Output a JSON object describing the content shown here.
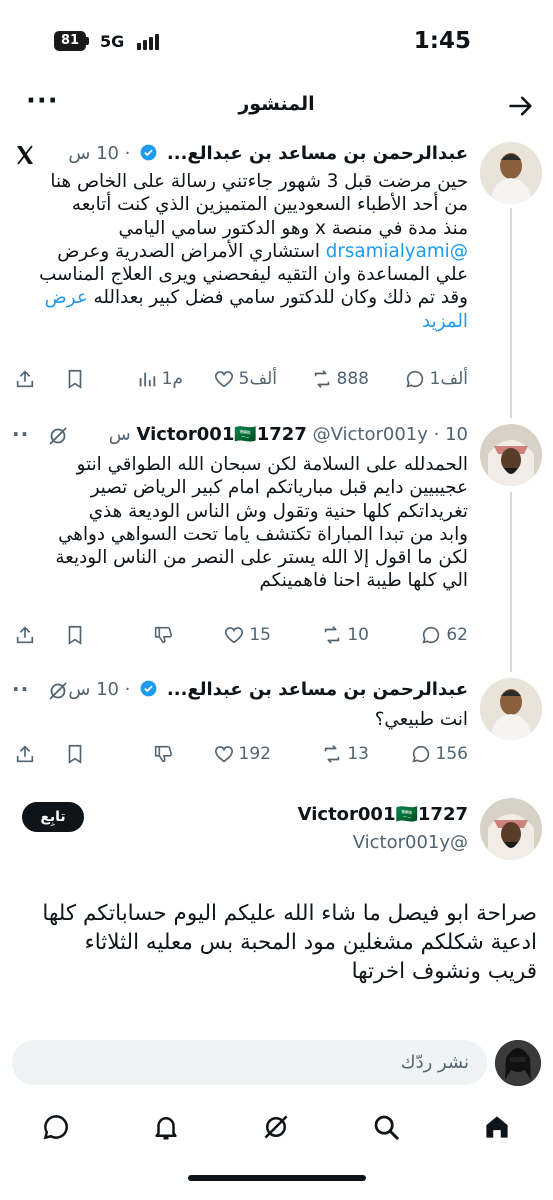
{
  "status_bar": {
    "time": "1:45",
    "battery": "81",
    "network": "5G"
  },
  "header": {
    "title": "المنشور",
    "back_icon": "arrow-right-icon",
    "more_icon": "more-dots-icon"
  },
  "posts": [
    {
      "name": "عبدالرحمن بن مساعد بن عبدالع...",
      "time": "10 س",
      "verified": true,
      "top_icon": "x-logo-icon",
      "text_lines": [
        "حين مرضت قبل 3 شهور جاءتني رسالة على الخاص هنا",
        "من أحد الأطباء السعوديين المتميزين الذي كنت أتابعه",
        "منذ مدة في منصة x وهو الدكتور سامي اليامي",
        "استشاري الأمراض الصدرية وعرض",
        "علي المساعدة وان التقيه ليفحصني ويرى العلاج المناسب",
        "وقد تم ذلك وكان للدكتور سامي فضل كبير بعدالله"
      ],
      "mention": "@drsamialyami",
      "show_more": "عرض المزيد",
      "show_more_1": "عرض",
      "show_more_2": "المزيد",
      "stats": {
        "replies": "1ألف",
        "reposts": "888",
        "likes": "5ألف",
        "views": "1م"
      }
    },
    {
      "name": "Victor001🇸🇦1727",
      "handle": "@Victor001y",
      "time": "10 س",
      "top_icon": "grok-icon",
      "text_lines": [
        "الحمدلله على السلامة لكن سبحان الله الطواقي انتو",
        "عجيبيين دايم قبل مبارياتكم امام كبير الرياض تصير",
        "تغريداتكم كلها حنية وتقول وش الناس الوديعة هذي",
        "وابد من تبدا المباراة تكتشف ياما تحت السواهي دواهي",
        "لكن ما اقول إلا الله يستر على النصر من الناس الوديعة",
        "الي كلها طيبة احنا فاهمينكم"
      ],
      "stats": {
        "replies": "62",
        "reposts": "10",
        "likes": "15"
      }
    },
    {
      "name": "عبدالرحمن بن مساعد بن عبدالع...",
      "time": "10 س",
      "verified": true,
      "top_icon": "grok-icon",
      "text_lines": [
        "انت طبيعي؟"
      ],
      "stats": {
        "replies": "156",
        "reposts": "13",
        "likes": "192"
      }
    }
  ],
  "focus_post": {
    "name": "Victor001🇸🇦1727",
    "handle": "@Victor001y",
    "follow_label": "تابِع",
    "text_lines": [
      "صراحة ابو فيصل ما شاء الله عليكم اليوم حساباتكم كلها",
      "ادعية شكلكم مشغلين مود المحبة بس معليه الثلاثاء",
      "قريب ونشوف اخرتها"
    ]
  },
  "reply_bar": {
    "placeholder": "نشر ردّك"
  },
  "bottom_nav": [
    "home-icon",
    "search-icon",
    "grok-icon",
    "notifications-icon",
    "messages-icon"
  ],
  "colors": {
    "accent": "#1d9bf0",
    "text": "#0f1419",
    "muted": "#536471",
    "thread_line": "#cfd9de"
  }
}
